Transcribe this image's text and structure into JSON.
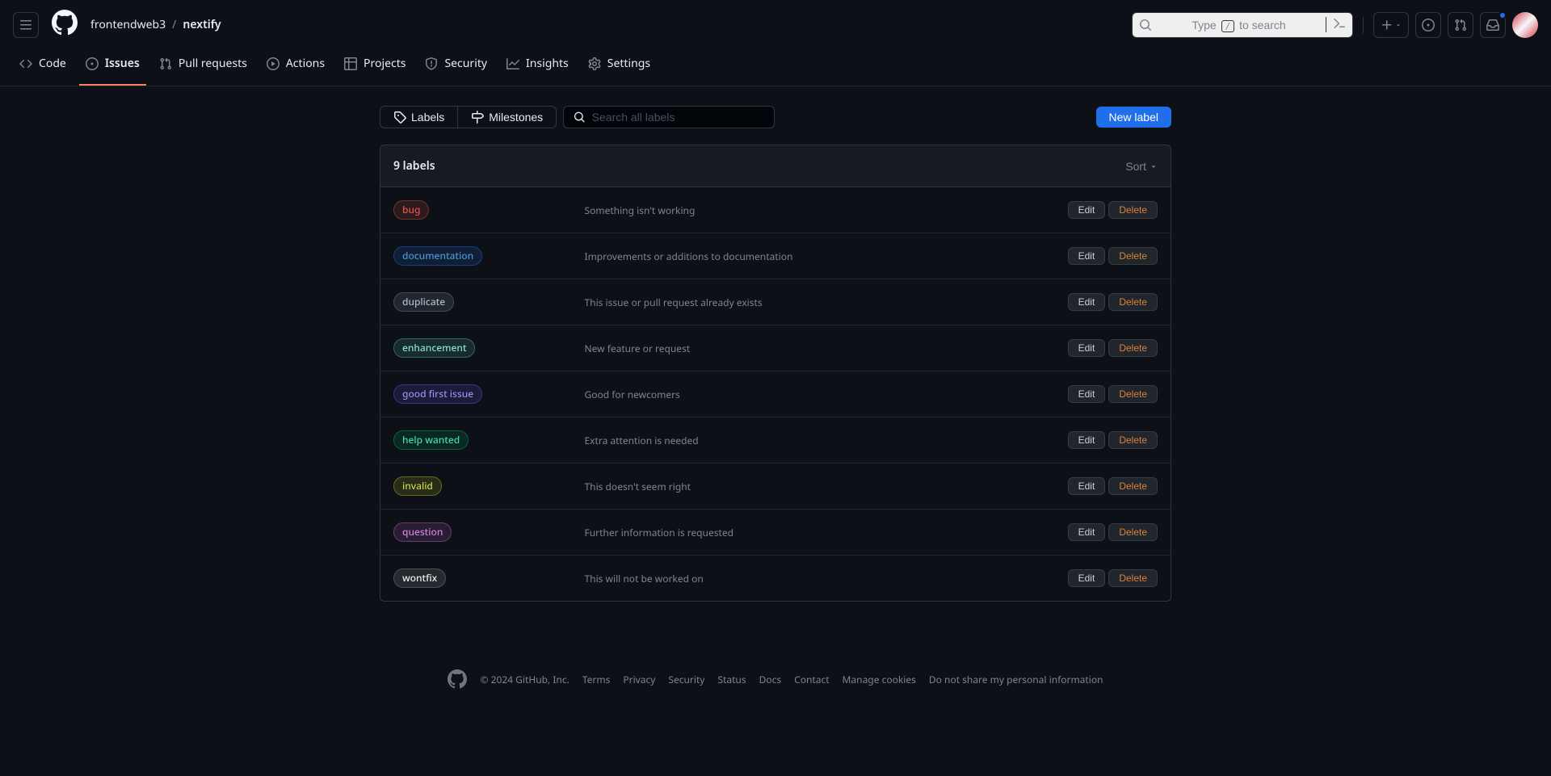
{
  "header": {
    "breadcrumb_owner": "frontendweb3",
    "breadcrumb_repo": "nextify",
    "search_prefix": "Type ",
    "search_key": "/",
    "search_suffix": " to search"
  },
  "nav": {
    "code": "Code",
    "issues": "Issues",
    "pull_requests": "Pull requests",
    "actions": "Actions",
    "projects": "Projects",
    "security": "Security",
    "insights": "Insights",
    "settings": "Settings"
  },
  "subnav": {
    "labels_tab": "Labels",
    "milestones_tab": "Milestones",
    "search_placeholder": "Search all labels",
    "new_label": "New label"
  },
  "list_header": {
    "count_text": "9 labels",
    "sort": "Sort"
  },
  "actions": {
    "edit": "Edit",
    "delete": "Delete"
  },
  "labels": [
    {
      "name": "bug",
      "desc": "Something isn't working",
      "fg": "#e5534b",
      "bg": "rgba(229,83,75,0.15)",
      "border": "rgba(229,83,75,0.4)"
    },
    {
      "name": "documentation",
      "desc": "Improvements or additions to documentation",
      "fg": "#4e94d4",
      "bg": "rgba(31,111,235,0.15)",
      "border": "rgba(31,111,235,0.4)"
    },
    {
      "name": "duplicate",
      "desc": "This issue or pull request already exists",
      "fg": "#adbac7",
      "bg": "rgba(118,131,144,0.2)",
      "border": "rgba(118,131,144,0.4)"
    },
    {
      "name": "enhancement",
      "desc": "New feature or request",
      "fg": "#8ddfd4",
      "bg": "rgba(87,194,179,0.15)",
      "border": "rgba(87,194,179,0.4)"
    },
    {
      "name": "good first issue",
      "desc": "Good for newcomers",
      "fg": "#9a8cf0",
      "bg": "rgba(112,87,255,0.15)",
      "border": "rgba(112,87,255,0.4)"
    },
    {
      "name": "help wanted",
      "desc": "Extra attention is needed",
      "fg": "#46d9a0",
      "bg": "rgba(0,179,110,0.15)",
      "border": "rgba(0,179,110,0.4)"
    },
    {
      "name": "invalid",
      "desc": "This doesn't seem right",
      "fg": "#cdd453",
      "bg": "rgba(192,202,33,0.15)",
      "border": "rgba(192,202,33,0.4)"
    },
    {
      "name": "question",
      "desc": "Further information is requested",
      "fg": "#d480e0",
      "bg": "rgba(204,102,214,0.15)",
      "border": "rgba(204,102,214,0.4)"
    },
    {
      "name": "wontfix",
      "desc": "This will not be worked on",
      "fg": "#e6edf3",
      "bg": "rgba(140,140,140,0.2)",
      "border": "rgba(140,140,140,0.4)"
    }
  ],
  "footer": {
    "copyright": "© 2024 GitHub, Inc.",
    "links": [
      "Terms",
      "Privacy",
      "Security",
      "Status",
      "Docs",
      "Contact",
      "Manage cookies",
      "Do not share my personal information"
    ]
  }
}
